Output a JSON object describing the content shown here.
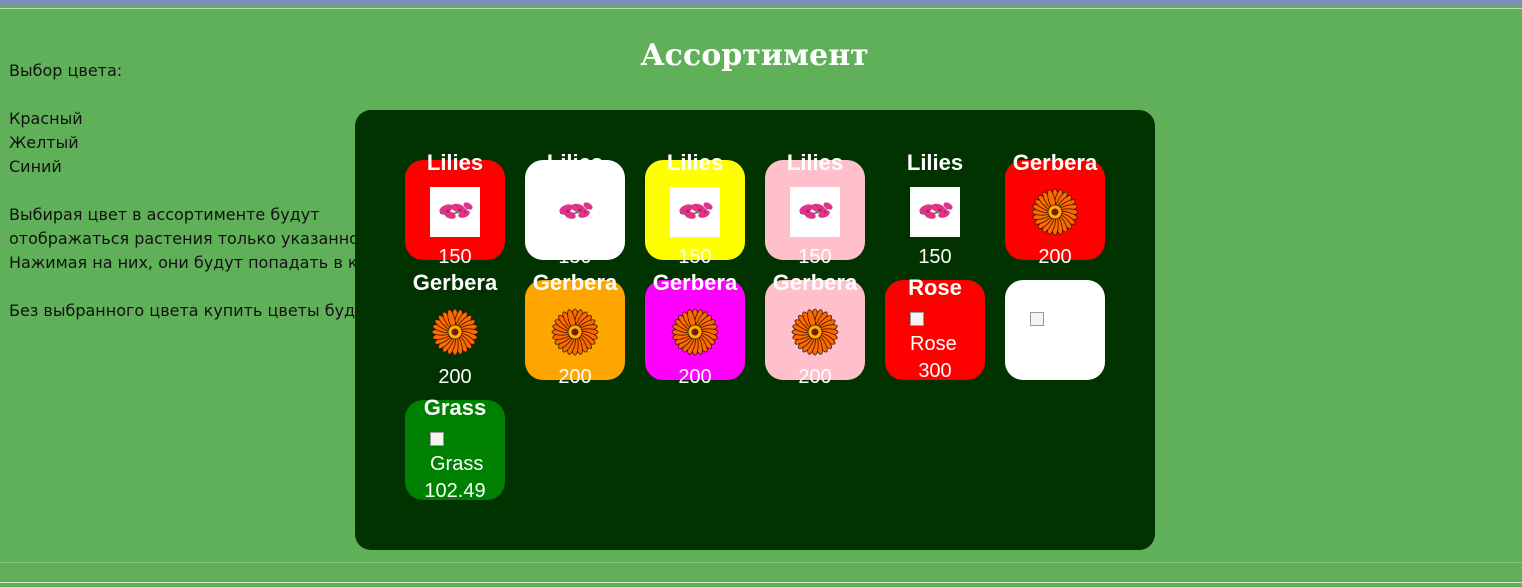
{
  "title": "Ассортимент",
  "sidebar": {
    "choose_color": "Выбор цвета:",
    "colors": [
      "Красный",
      "Желтый",
      "Синий"
    ],
    "desc1": "Выбирая цвет в ассортименте будут",
    "desc2": "отображаться растения только указанного цвета",
    "desc3": "Нажимая на них, они будут попадать в корзину",
    "warning": "Без выбранного цвета купить цветы будет нельзя!"
  },
  "products": [
    {
      "name": "Lilies",
      "price": "150",
      "bg": "#ff0000",
      "icon": "lily-image"
    },
    {
      "name": "Lilies",
      "price": "150",
      "bg": "#ffffff",
      "icon": "lily-image"
    },
    {
      "name": "Lilies",
      "price": "150",
      "bg": "#ffff00",
      "icon": "lily-image"
    },
    {
      "name": "Lilies",
      "price": "150",
      "bg": "#ffc0cb",
      "icon": "lily-image"
    },
    {
      "name": "Lilies",
      "price": "150",
      "bg": "#003300",
      "icon": "lily-image"
    },
    {
      "name": "Gerbera",
      "price": "200",
      "bg": "#ff0000",
      "icon": "gerbera-image"
    },
    {
      "name": "Gerbera",
      "price": "200",
      "bg": "#003300",
      "icon": "gerbera-image"
    },
    {
      "name": "Gerbera",
      "price": "200",
      "bg": "#ffa500",
      "icon": "gerbera-image"
    },
    {
      "name": "Gerbera",
      "price": "200",
      "bg": "#ff00ff",
      "icon": "gerbera-image"
    },
    {
      "name": "Gerbera",
      "price": "200",
      "bg": "#ffc0cb",
      "icon": "gerbera-image"
    },
    {
      "name": "Rose",
      "price": "300",
      "bg": "#ff0000",
      "icon": "broken-image",
      "alt": "Rose"
    },
    {
      "name": "",
      "price": "",
      "bg": "#ffffff",
      "icon": "broken-image",
      "alt": ""
    },
    {
      "name": "Grass",
      "price": "102.49",
      "bg": "#008000",
      "icon": "broken-image",
      "alt": "Grass"
    }
  ]
}
